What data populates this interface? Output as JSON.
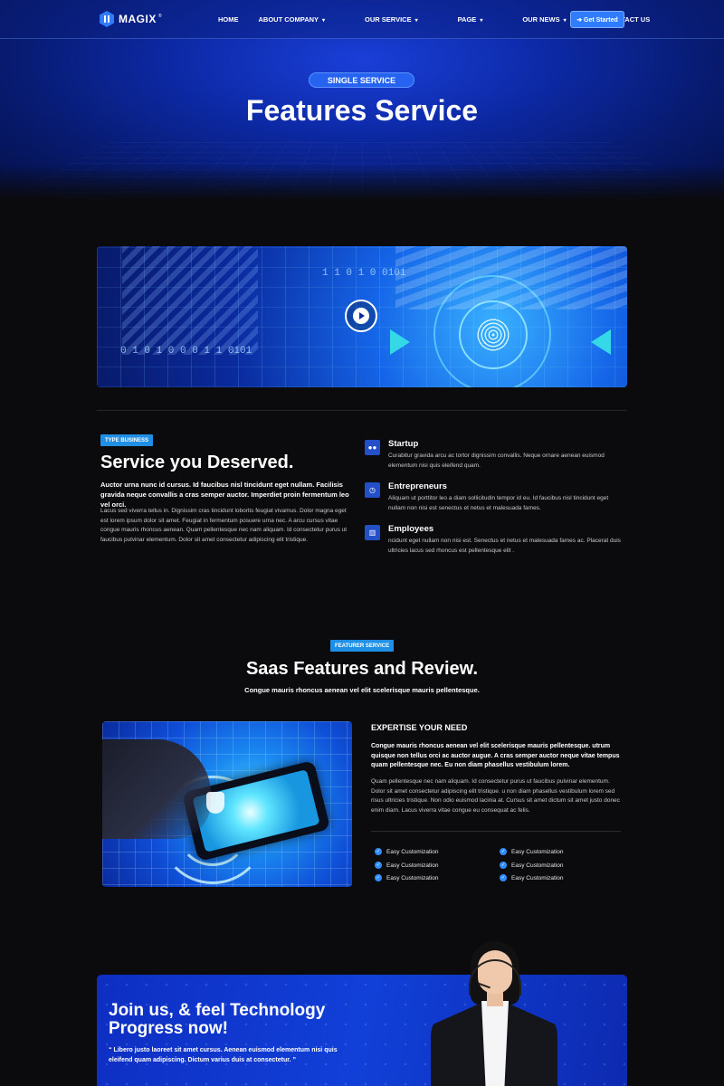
{
  "nav": {
    "logo_text": "MAGIX",
    "logo_mark": "®",
    "items": [
      {
        "label": "HOME",
        "caret": ""
      },
      {
        "label": "ABOUT COMPANY",
        "caret": "▾"
      },
      {
        "label": "OUR SERVICE",
        "caret": "▾"
      },
      {
        "label": "PAGE",
        "caret": "▾"
      },
      {
        "label": "OUR NEWS",
        "caret": "▾"
      },
      {
        "label": "CONTACT US",
        "caret": ""
      }
    ],
    "cta_label": "➔ Get Started"
  },
  "hero": {
    "pill": "SINGLE SERVICE",
    "title": "Features Service"
  },
  "video": {
    "binary_1": "1 1     0 1 0     0101",
    "binary_2": "0 1 0 1  0 0  0 1 1        0101"
  },
  "service": {
    "tag": "TYPE BUSINESS",
    "title": "Service you Deserved.",
    "lead": "Auctor urna nunc id cursus. Id faucibus nisl tincidunt eget nullam. Facilisis gravida neque convallis a cras semper auctor. Imperdiet proin fermentum leo vel orci.",
    "body": "Lacus sed viverra tellus in. Dignissim cras tincidunt lobortis feugiat vivamus. Dolor magna eget est lorem ipsum dolor sit amet. Feugiat in fermentum posuere urna nec. A arcu cursus vitae congue mauris rhoncus aenean. Quam pellentesque nec nam aliquam. Id consectetur purus ut faucibus pulvinar elementum. Dolor sit amet consectetur adipiscing elit tristique.",
    "features": [
      {
        "title": "Startup",
        "desc": "Curabitur gravida arcu ac tortor dignissim convallis. Neque ornare aenean euismod elementum nisi quis eleifend quam.",
        "icon": "users-icon"
      },
      {
        "title": "Entrepreneurs",
        "desc": "Aliquam ut porttitor leo a diam sollicitudin tempor id eu. Id faucibus nisl tincidunt eget nullam non nisi est senectus et netus et malesuada fames.",
        "icon": "clock-icon"
      },
      {
        "title": "Employees",
        "desc": "ncidunt eget nullam non nisi est. Senectus et netus et malesuada fames ac. Placerat duis ultricies lacus sed rhoncus est pellentesque elit .",
        "icon": "chart-icon"
      }
    ]
  },
  "saas": {
    "tag": "FEATURER SERVICE",
    "title": "Saas Features and Review.",
    "subtitle": "Congue mauris rhoncus aenean vel elit scelerisque mauris pellentesque.",
    "expertise_heading": "EXPERTISE YOUR NEED",
    "expertise_lead": "Congue mauris rhoncus aenean vel elit scelerisque mauris pellentesque. utrum quisque non tellus orci ac auctor augue. A cras semper auctor neque vitae tempus quam pellentesque nec. Eu non diam phasellus vestibulum lorem.",
    "expertise_body": "Quam pellentesque nec nam aliquam. Id consectetur purus ut faucibus pulvinar elementum. Dolor sit amet consectetur adipiscing elit tristique. u non diam phasellus vestibulum lorem sed risus ultricies tristique. Non odio euismod lacinia at. Cursus sit amet dictum sit amet justo donec enim diam. Lacus viverra vitae congue eu consequat ac felis.",
    "checks": [
      "Easy Customization",
      "Easy Customization",
      "Easy Customization",
      "Easy Customization",
      "Easy Customization",
      "Easy Customization"
    ]
  },
  "cta": {
    "title": "Join us, & feel Technology Progress now!",
    "quote": "“ Libero justo laoreet sit amet cursus. Aenean euismod elementum nisi quis eleifend quam adipiscing. Dictum varius duis at consectetur. ”"
  },
  "colors": {
    "accent": "#2f7cff",
    "tag": "#1f8fe6",
    "background": "#0b0b0d",
    "hero": "#0d2aa8"
  }
}
